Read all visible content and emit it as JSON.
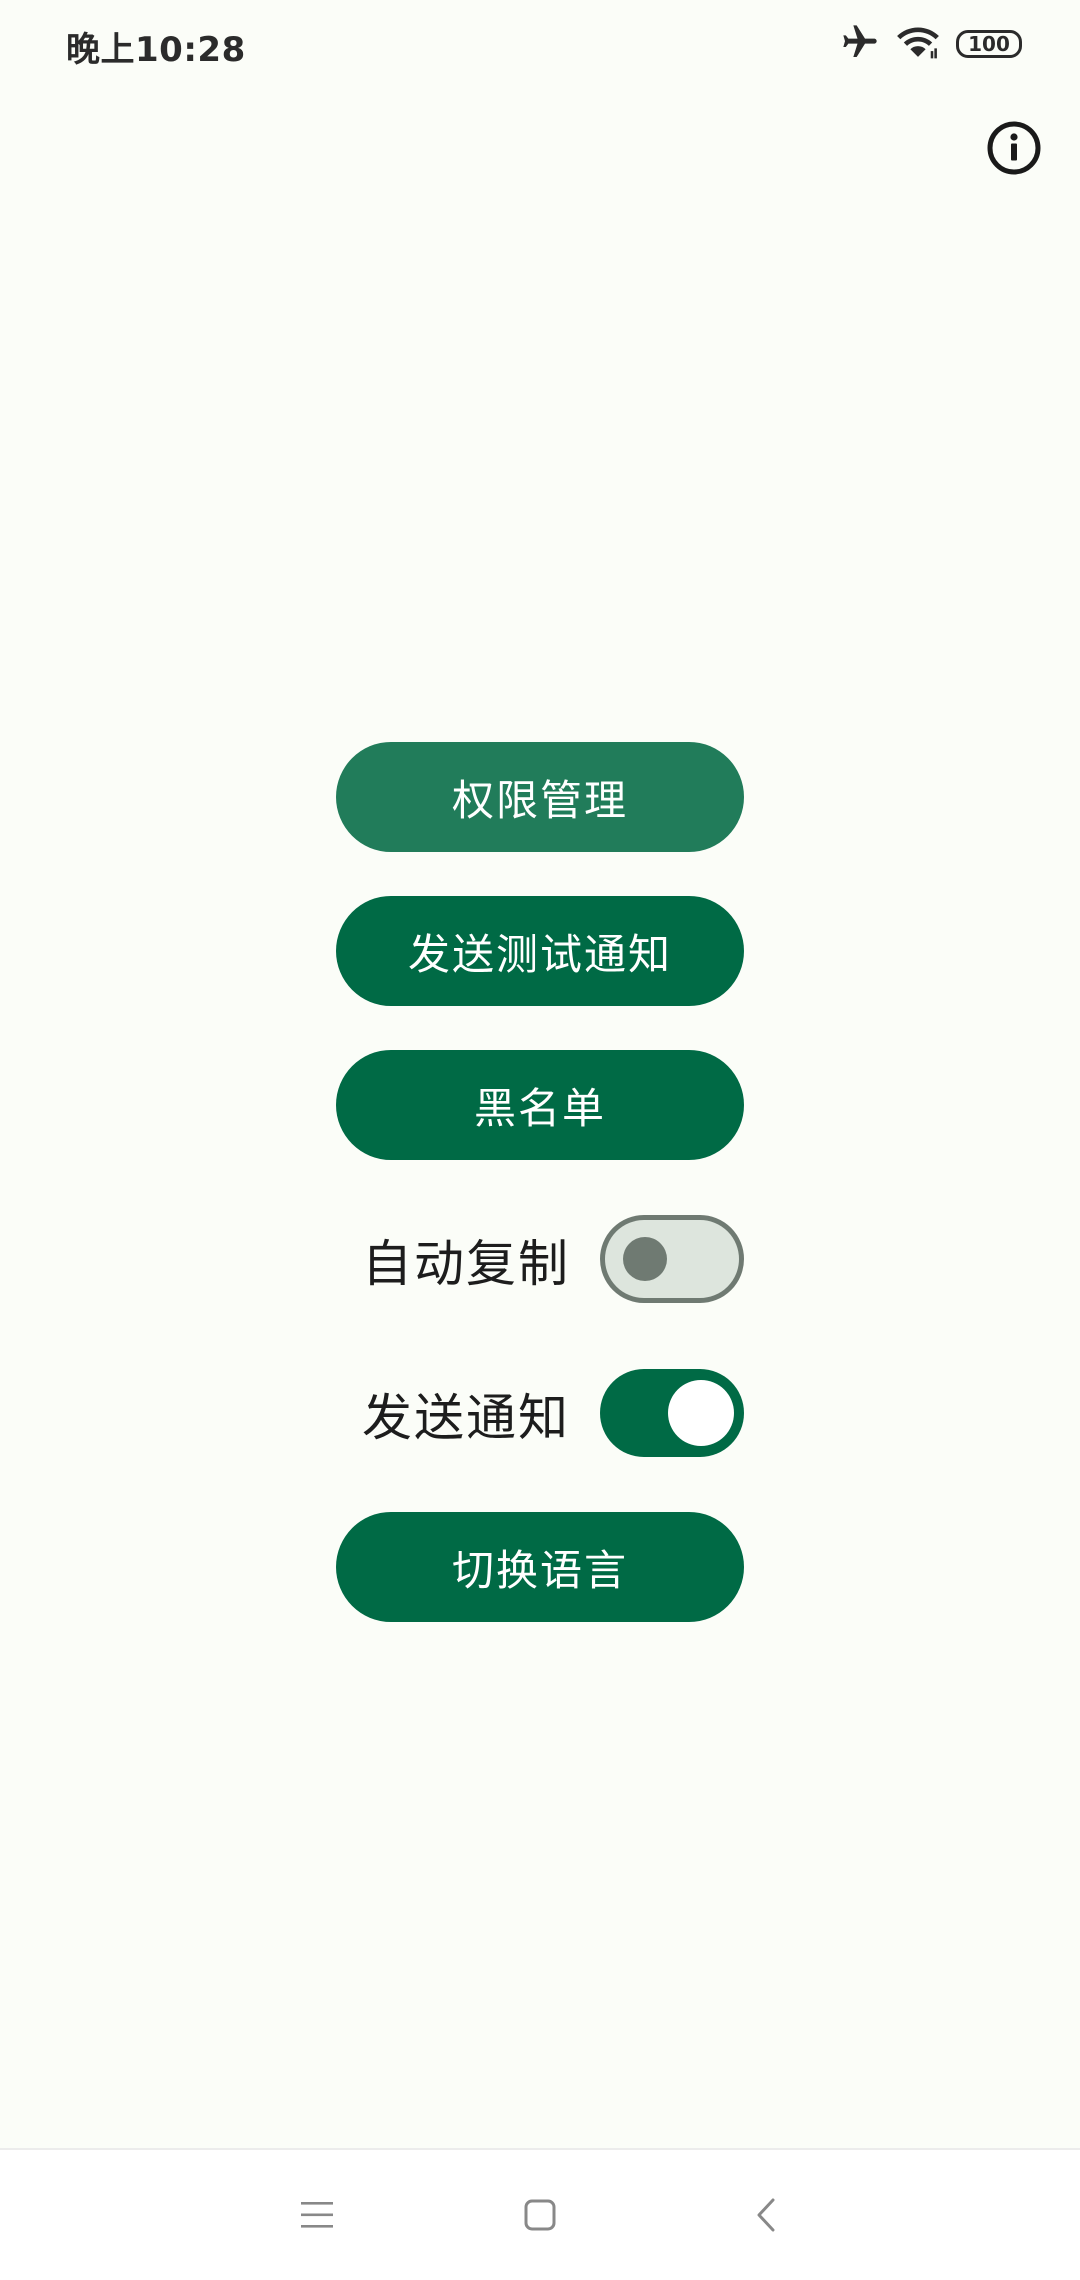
{
  "status_bar": {
    "time": "晚上10:28",
    "battery": "100",
    "icons": [
      "airplane-icon",
      "wifi-icon",
      "battery-icon"
    ]
  },
  "toolbar": {
    "info_icon": "info-icon"
  },
  "main": {
    "buttons": {
      "permissions": "权限管理",
      "send_test": "发送测试通知",
      "blacklist": "黑名单",
      "switch_language": "切换语言"
    },
    "switches": {
      "auto_copy": {
        "label": "自动复制",
        "state": "off"
      },
      "send_notification": {
        "label": "发送通知",
        "state": "on"
      }
    }
  },
  "nav_bar": {
    "icons": [
      "menu-icon",
      "home-icon",
      "back-icon"
    ]
  },
  "colors": {
    "primary": "#006a45",
    "primary_focused": "#217c5a",
    "background": "#fbfdf8",
    "switch_off_track": "#dde5dd",
    "switch_off_outline": "#6f7a72"
  }
}
